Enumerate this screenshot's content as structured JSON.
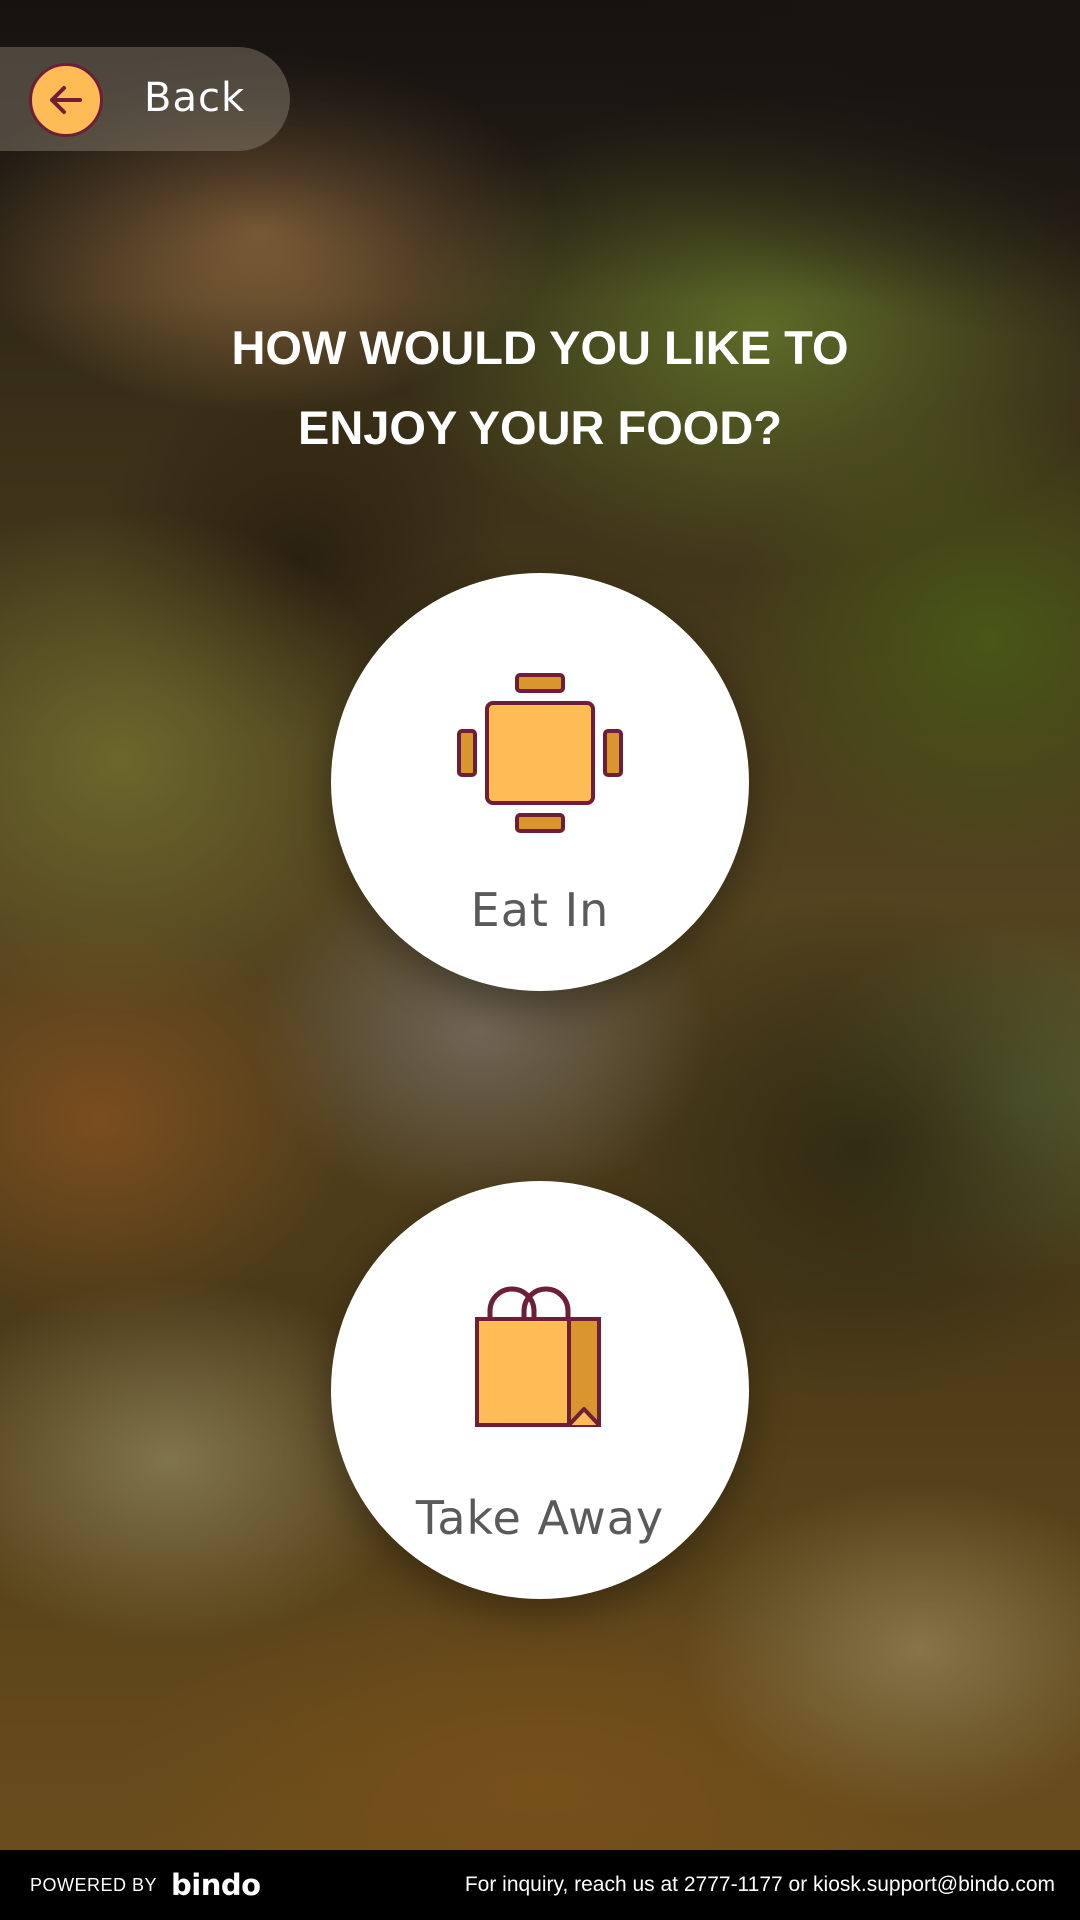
{
  "back": {
    "label": "Back",
    "icon": "arrow-left-icon"
  },
  "question": {
    "line1": "HOW WOULD YOU LIKE TO",
    "line2": "ENJOY YOUR FOOD?"
  },
  "options": [
    {
      "label": "Eat In",
      "icon": "dining-table-icon"
    },
    {
      "label": "Take Away",
      "icon": "shopping-bag-icon"
    }
  ],
  "footer": {
    "powered_by": "POWERED BY",
    "brand": "bindo",
    "inquiry": "For inquiry, reach us at 2777-1177 or  kiosk.support@bindo.com"
  },
  "colors": {
    "accent": "#ffbb55",
    "accent_dark": "#d9962e",
    "outline": "#6d1f38",
    "option_bg": "#ffffff",
    "option_text": "#5a5a5a",
    "footer_bg": "#000000"
  }
}
